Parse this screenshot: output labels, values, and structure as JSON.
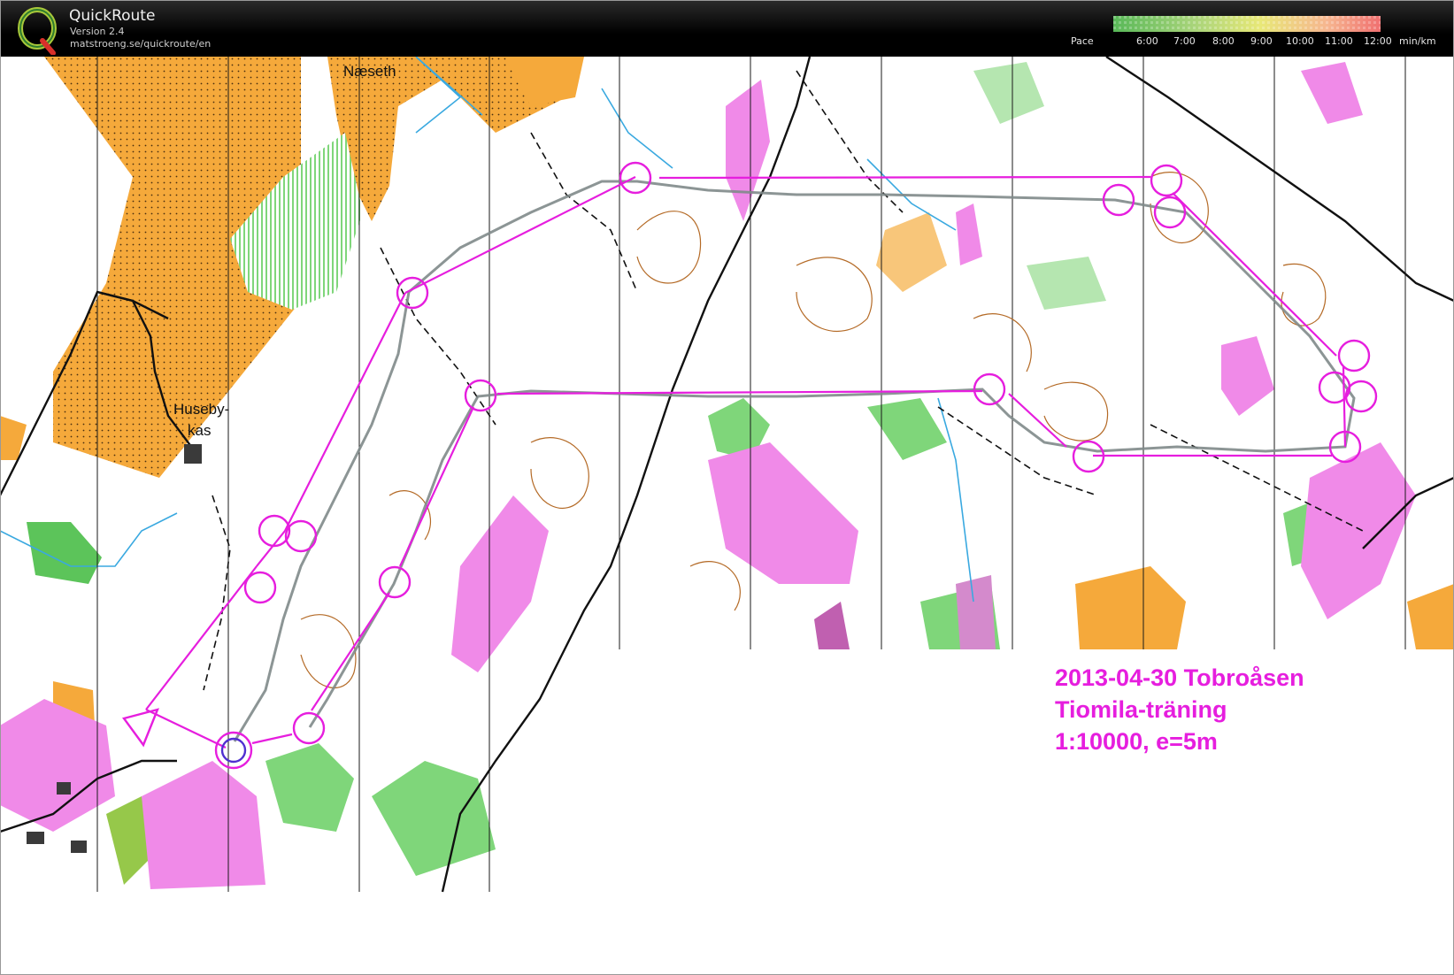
{
  "app": {
    "name": "QuickRoute",
    "version": "Version 2.4",
    "url": "matstroeng.se/quickroute/en",
    "logo_icon": "quickroute-q-logo-icon"
  },
  "pace_legend": {
    "label": "Pace",
    "ticks": [
      "6:00",
      "7:00",
      "8:00",
      "9:00",
      "10:00",
      "11:00",
      "12:00"
    ],
    "unit": "min/km",
    "gradient_colors": [
      "#58b858",
      "#a8d47a",
      "#e8e878",
      "#f6b690",
      "#f07070"
    ]
  },
  "map": {
    "place_names": [
      "Næseth",
      "Huseby-",
      "kas"
    ],
    "caption": {
      "line1": "2013-04-30 Tobroåsen",
      "line2": "Tiomila-träning",
      "line3": "1:10000, e=5m"
    },
    "colors": {
      "open_land": "#f5a93b",
      "forest_white": "#ffffff",
      "green_vegetation": "#7fd67a",
      "contour_brown": "#b46a26",
      "water_blue": "#3aa9e0",
      "marsh_pink": "#f08ae8",
      "course_magenta": "#e61ede",
      "route_gray": "#7f8a8a"
    }
  }
}
